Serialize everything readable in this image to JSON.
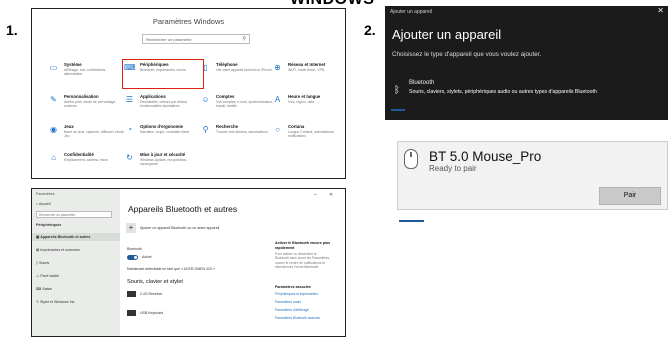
{
  "header": "WINDOWS",
  "numbers": {
    "n1": "1.",
    "n2": "2."
  },
  "settings": {
    "title": "Paramètres Windows",
    "search_placeholder": "Rechercher un paramètre",
    "categories": [
      {
        "icon": "laptop-icon",
        "glyph": "▭",
        "title": "Système",
        "desc": "Affichage, son, notifications, alimentation",
        "highlight": false
      },
      {
        "icon": "keyboard-icon",
        "glyph": "⌨",
        "title": "Périphériques",
        "desc": "Bluetooth, imprimantes, souris",
        "highlight": true
      },
      {
        "icon": "phone-icon",
        "glyph": "▯",
        "title": "Téléphone",
        "desc": "Lier votre appareil Android ou iPhone",
        "highlight": false
      },
      {
        "icon": "globe-icon",
        "glyph": "⊕",
        "title": "Réseau et Internet",
        "desc": "Wi-Fi, mode Avion, VPN",
        "highlight": false
      },
      {
        "icon": "paint-icon",
        "glyph": "✎",
        "title": "Personnalisation",
        "desc": "Arrière-plan, écran de verrouillage, couleurs",
        "highlight": false
      },
      {
        "icon": "apps-icon",
        "glyph": "☰",
        "title": "Applications",
        "desc": "Désinstaller, valeurs par défaut, fonctionnalités facultatives",
        "highlight": false
      },
      {
        "icon": "person-icon",
        "glyph": "☺",
        "title": "Comptes",
        "desc": "Vos comptes, e-mail, synchronisation, travail, famille",
        "highlight": false
      },
      {
        "icon": "language-icon",
        "glyph": "A",
        "title": "Heure et langue",
        "desc": "Voix, région, date",
        "highlight": false
      },
      {
        "icon": "gamepad-icon",
        "glyph": "◉",
        "title": "Jeux",
        "desc": "Barre de jeux, captures, diffusion, Mode Jeu",
        "highlight": false
      },
      {
        "icon": "accessibility-icon",
        "glyph": "◔",
        "title": "Options d'ergonomie",
        "desc": "Narrateur, loupe, contraste élevé",
        "highlight": false
      },
      {
        "icon": "search-icon",
        "glyph": "⚲",
        "title": "Recherche",
        "desc": "Trouver mes fichiers, autorisations",
        "highlight": false
      },
      {
        "icon": "cortana-icon",
        "glyph": "○",
        "title": "Cortana",
        "desc": "Langue Cortana, autorisations, notifications",
        "highlight": false
      },
      {
        "icon": "lock-icon",
        "glyph": "⌂",
        "title": "Confidentialité",
        "desc": "Emplacement, caméra, micro",
        "highlight": false
      },
      {
        "icon": "update-icon",
        "glyph": "↻",
        "title": "Mise à jour et sécurité",
        "desc": "Windows Update, récupération, sauvegarde",
        "highlight": false
      }
    ]
  },
  "add_device": {
    "titlebar": "Ajouter un appareil",
    "close": "✕",
    "title": "Ajouter un appareil",
    "subtitle": "Choisissez le type d'appareil que vous voulez ajouter.",
    "bt_title": "Bluetooth",
    "bt_desc": "Souris, claviers, stylets, périphériques audio ou autres types d'appareils Bluetooth"
  },
  "toast": {
    "title": "BT 5.0 Mouse_Pro",
    "status": "Ready to pair",
    "button": "Pair"
  },
  "bt_settings": {
    "sidebar": {
      "home": "Accueil",
      "search_placeholder": "Rechercher un paramètre",
      "heading": "Périphériques",
      "items": [
        "Appareils Bluetooth et autres",
        "Imprimantes et scanners",
        "Souris",
        "Pavé tactile",
        "Saisie",
        "Stylet et Windows Ink"
      ],
      "top": "Paramètres"
    },
    "title": "Appareils Bluetooth et autres",
    "add_label": "Ajouter un appareil Bluetooth ou un autre appareil",
    "bt_label": "Bluetooth",
    "bt_state": "Activé",
    "detectable": "Maintenant détectable en tant que « ACER-OMEN 320 »",
    "section": "Souris, clavier et stylet",
    "devices": [
      "2.4G Receiver",
      "USB Keyboard"
    ],
    "right_heading": "Activer le Bluetooth encore plus rapidement",
    "right_text": "Pour activer ou désactiver le Bluetooth sans ouvrir les Paramètres, ouvrez le centre de notifications et sélectionnez l'icône Bluetooth.",
    "related_heading": "Paramètres associés",
    "related_links": [
      "Périphériques et imprimantes",
      "Paramètres audio",
      "Paramètres d'affichage",
      "Paramètres Bluetooth avancés"
    ],
    "win_min": "–",
    "win_close": "✕"
  }
}
